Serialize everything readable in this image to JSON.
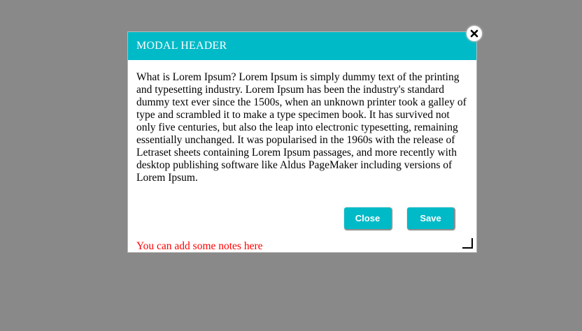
{
  "modal": {
    "title": "MODAL HEADER",
    "body": "What is Lorem Ipsum? Lorem Ipsum is simply dummy text of the printing and typesetting industry. Lorem Ipsum has been the industry's standard dummy text ever since the 1500s, when an unknown printer took a galley of type and scrambled it to make a type specimen book. It has survived not only five centuries, but also the leap into electronic typesetting, remaining essentially unchanged. It was popularised in the 1960s with the release of Letraset sheets containing Lorem Ipsum passages, and more recently with desktop publishing software like Aldus PageMaker including versions of Lorem Ipsum.",
    "close_label": "Close",
    "save_label": "Save",
    "notes": "You can add some notes here",
    "close_icon": "close-icon",
    "resize_icon": "resize-handle-icon"
  },
  "colors": {
    "overlay": "#898989",
    "header": "#00bac7",
    "button": "#00bac7",
    "notes": "#ff0000"
  }
}
